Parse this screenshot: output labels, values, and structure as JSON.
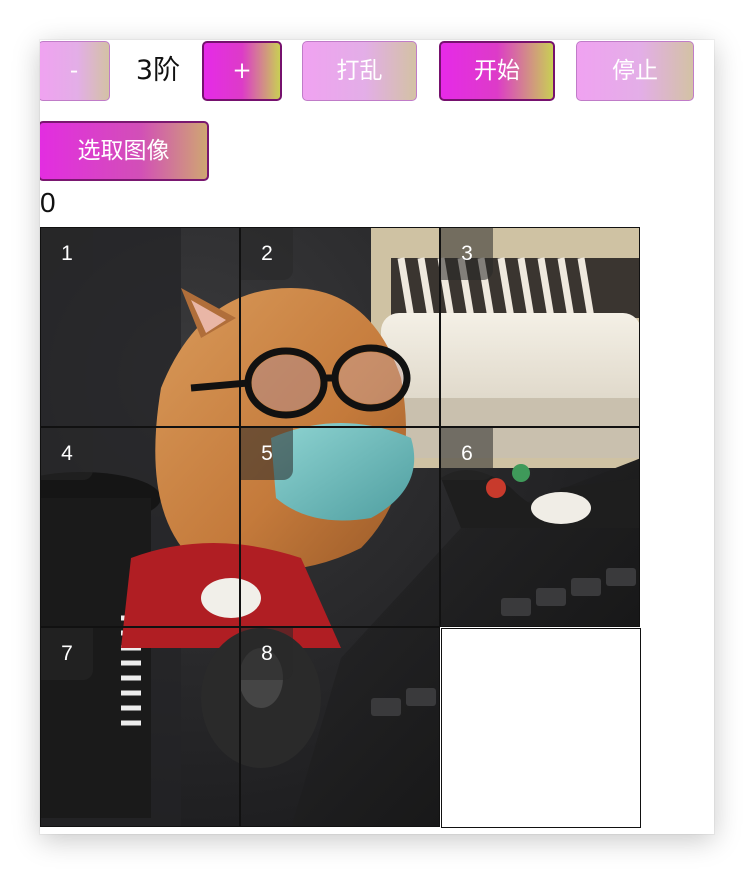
{
  "controls": {
    "minus_label": "-",
    "level_label": "3阶",
    "plus_label": "+",
    "shuffle_label": "打乱",
    "start_label": "开始",
    "stop_label": "停止",
    "pick_image_label": "选取图像"
  },
  "status": {
    "step_count": "0"
  },
  "puzzle": {
    "order": 3,
    "tiles": [
      {
        "label": "1"
      },
      {
        "label": "2"
      },
      {
        "label": "3"
      },
      {
        "label": "4"
      },
      {
        "label": "5"
      },
      {
        "label": "6"
      },
      {
        "label": "7"
      },
      {
        "label": "8"
      }
    ]
  },
  "colors": {
    "button_soft_gradient": [
      "#f0a2f1",
      "#d3c2a4"
    ],
    "button_strong_gradient": [
      "#e62ae8",
      "#c9cf54"
    ],
    "grid_line": "#111111"
  }
}
